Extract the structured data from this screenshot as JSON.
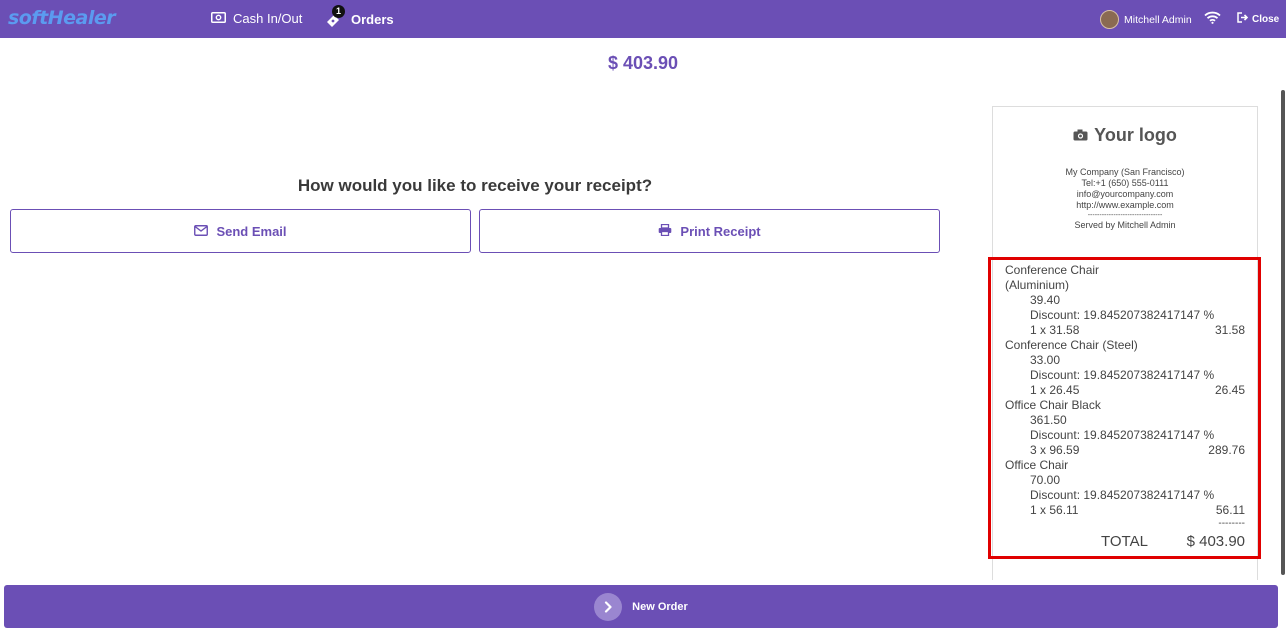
{
  "header": {
    "brand": "softHealer",
    "brand_color": "#5b9bf0",
    "cash_label": "Cash In/Out",
    "orders_label": "Orders",
    "orders_badge": "1",
    "user_name": "Mitchell Admin",
    "close_label": "Close",
    "accent": "#6b4fb5"
  },
  "main": {
    "amount": "$ 403.90",
    "question": "How would you like to receive your receipt?",
    "email_button": "Send Email",
    "print_button": "Print Receipt"
  },
  "receipt": {
    "logo_text": "Your logo",
    "company_lines": [
      "My Company (San Francisco)",
      "Tel:+1 (650) 555-0111",
      "info@yourcompany.com",
      "http://www.example.com",
      "--------------------------------",
      "Served by Mitchell Admin"
    ],
    "items": [
      {
        "name": "Conference Chair (Aluminium)",
        "name_line1": "Conference Chair",
        "name_line2": "(Aluminium)",
        "unit_price": "39.40",
        "discount": "Discount: 19.845207382417147 %",
        "qty_line": "1 x 31.58",
        "line_total": "31.58"
      },
      {
        "name": "Conference Chair (Steel)",
        "unit_price": "33.00",
        "discount": "Discount: 19.845207382417147 %",
        "qty_line": "1 x 26.45",
        "line_total": "26.45"
      },
      {
        "name": "Office Chair Black",
        "unit_price": "361.50",
        "discount": "Discount: 19.845207382417147 %",
        "qty_line": "3 x 96.59",
        "line_total": "289.76"
      },
      {
        "name": "Office Chair",
        "unit_price": "70.00",
        "discount": "Discount: 19.845207382417147 %",
        "qty_line": "1 x 56.11",
        "line_total": "56.11"
      }
    ],
    "separator": "--------",
    "total_label": "TOTAL",
    "total_value": "$ 403.90",
    "highlight_color": "#e00000"
  },
  "footer": {
    "new_order_label": "New Order"
  }
}
